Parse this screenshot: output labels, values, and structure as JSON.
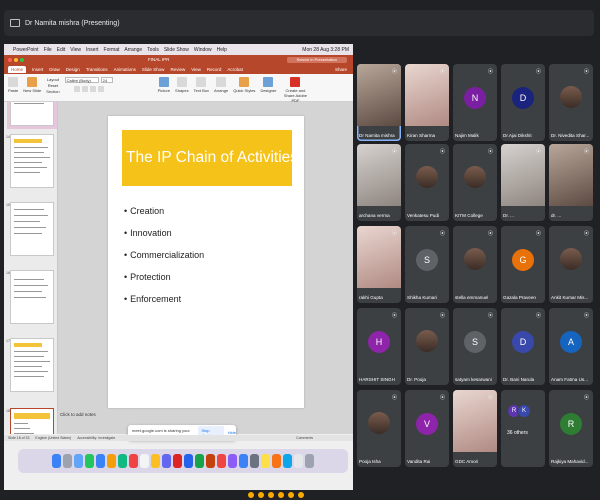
{
  "meet": {
    "presenter_label": "Dr Namita mishra (Presenting)"
  },
  "mac": {
    "menus": [
      "PowerPoint",
      "File",
      "Edit",
      "View",
      "Insert",
      "Format",
      "Arrange",
      "Tools",
      "Slide Show",
      "Window",
      "Help"
    ],
    "clock": "Mon 28 Aug 3:28 PM"
  },
  "ppt": {
    "file_title": "FINAL IPR",
    "search_placeholder": "Search in Presentation",
    "ribbon_tabs": [
      "Home",
      "Insert",
      "Draw",
      "Design",
      "Transitions",
      "Animations",
      "Slide Show",
      "Review",
      "View",
      "Record",
      "Acrobat"
    ],
    "share_label": "Share",
    "font_name": "Calibri (Body)",
    "font_size": "24",
    "ribbon_labels": {
      "paste": "Paste",
      "new_slide": "New Slide",
      "layout": "Layout",
      "reset": "Reset",
      "section": "Section",
      "picture": "Picture",
      "shapes": "Shapes",
      "text_box": "Text Box",
      "arrange": "Arrange",
      "quick_styles": "Quick Styles",
      "designer": "Designer",
      "create_pdf": "Create and Share Adobe PDF"
    },
    "slide": {
      "title": "The IP Chain of Activities",
      "bullets": [
        "Creation",
        "Innovation",
        "Commercialization",
        "Protection",
        "Enforcement"
      ]
    },
    "notes_placeholder": "Click to add notes",
    "status": {
      "slide_count": "Slide 18 of 33",
      "language": "English (United States)",
      "accessibility": "Accessibility: Investigate",
      "comments": "Comments"
    },
    "thumb_numbers": [
      "14",
      "15",
      "16",
      "17",
      "18"
    ]
  },
  "share_toast": {
    "message": "meet.google.com is sharing your screen.",
    "stop_label": "Stop sharing",
    "hide_label": "Hide"
  },
  "participants": [
    {
      "name": "Dr Namita mishra",
      "kind": "video",
      "initial": ""
    },
    {
      "name": "Kiran Sharma",
      "kind": "video",
      "initial": ""
    },
    {
      "name": "Najim Malik",
      "kind": "avatar",
      "initial": "N",
      "color": "#7b1fa2"
    },
    {
      "name": "Dr.Ajai Dikshit",
      "kind": "avatar",
      "initial": "D",
      "color": "#1a237e"
    },
    {
      "name": "Dr. Nivedita Shar...",
      "kind": "photo",
      "initial": ""
    },
    {
      "name": "archana verma",
      "kind": "video",
      "initial": ""
    },
    {
      "name": "Venkatesu Pudi",
      "kind": "photo",
      "initial": ""
    },
    {
      "name": "KITM College",
      "kind": "photo",
      "initial": ""
    },
    {
      "name": "Dr. ...",
      "kind": "video",
      "initial": ""
    },
    {
      "name": "dr. ...",
      "kind": "video",
      "initial": ""
    },
    {
      "name": "rakhi Gupta",
      "kind": "video",
      "initial": ""
    },
    {
      "name": "Shikha Kumari",
      "kind": "avatar",
      "initial": "S",
      "color": "#5f6368"
    },
    {
      "name": "stella emmanuel",
      "kind": "photo",
      "initial": ""
    },
    {
      "name": "Gazala Praveen",
      "kind": "avatar",
      "initial": "G",
      "color": "#e8710a"
    },
    {
      "name": "Ankit Kumar Mis...",
      "kind": "photo",
      "initial": ""
    },
    {
      "name": "HARSHIT SINGH",
      "kind": "avatar",
      "initial": "H",
      "color": "#8e24aa"
    },
    {
      "name": "Dr. Pooja",
      "kind": "photo",
      "initial": ""
    },
    {
      "name": "satyam kesarwani",
      "kind": "avatar",
      "initial": "S",
      "color": "#5f6368"
    },
    {
      "name": "Dr. Bani Narula",
      "kind": "avatar",
      "initial": "D",
      "color": "#3949ab"
    },
    {
      "name": "Anam Fatma Us...",
      "kind": "avatar",
      "initial": "A",
      "color": "#1565c0"
    },
    {
      "name": "Pooja Isha",
      "kind": "photo",
      "initial": ""
    },
    {
      "name": "Vandita Rai",
      "kind": "avatar",
      "initial": "V",
      "color": "#8e24aa"
    },
    {
      "name": "GDC Amori",
      "kind": "video",
      "initial": ""
    },
    {
      "name": "36 others",
      "kind": "others",
      "initial": ""
    },
    {
      "name": "Rajkiya Mahavid...",
      "kind": "avatar",
      "initial": "R",
      "color": "#2e7d32"
    }
  ],
  "others_initials": [
    {
      "initial": "R",
      "color": "#5e35b1"
    },
    {
      "initial": "K",
      "color": "#3949ab"
    }
  ],
  "colors": {
    "ppt_accent": "#b7472a",
    "slide_title_bg": "#f5c219",
    "meet_bg": "#202124",
    "tile_bg": "#3c4043"
  }
}
